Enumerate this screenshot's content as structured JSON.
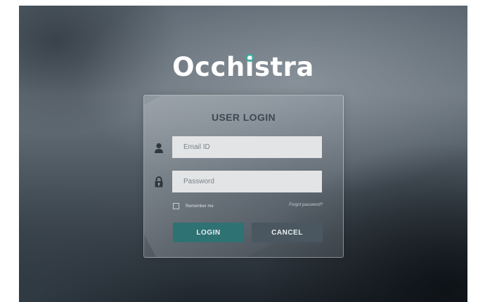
{
  "brand": {
    "logo_prefix": "Occh",
    "logo_i": "i",
    "logo_suffix": "stra",
    "accent_color": "#2fb3a8"
  },
  "login_form": {
    "title": "USER LOGIN",
    "email_field": {
      "placeholder": "Email ID",
      "value": "",
      "icon": "user-icon"
    },
    "password_field": {
      "placeholder": "Password",
      "value": "",
      "icon": "lock-icon"
    },
    "remember_label": "Remember me",
    "remember_checked": false,
    "forgot_label": "Forgot password?",
    "login_label": "LOGIN",
    "cancel_label": "CANCEL",
    "login_color": "#2f7273",
    "cancel_color": "#4a5761"
  }
}
